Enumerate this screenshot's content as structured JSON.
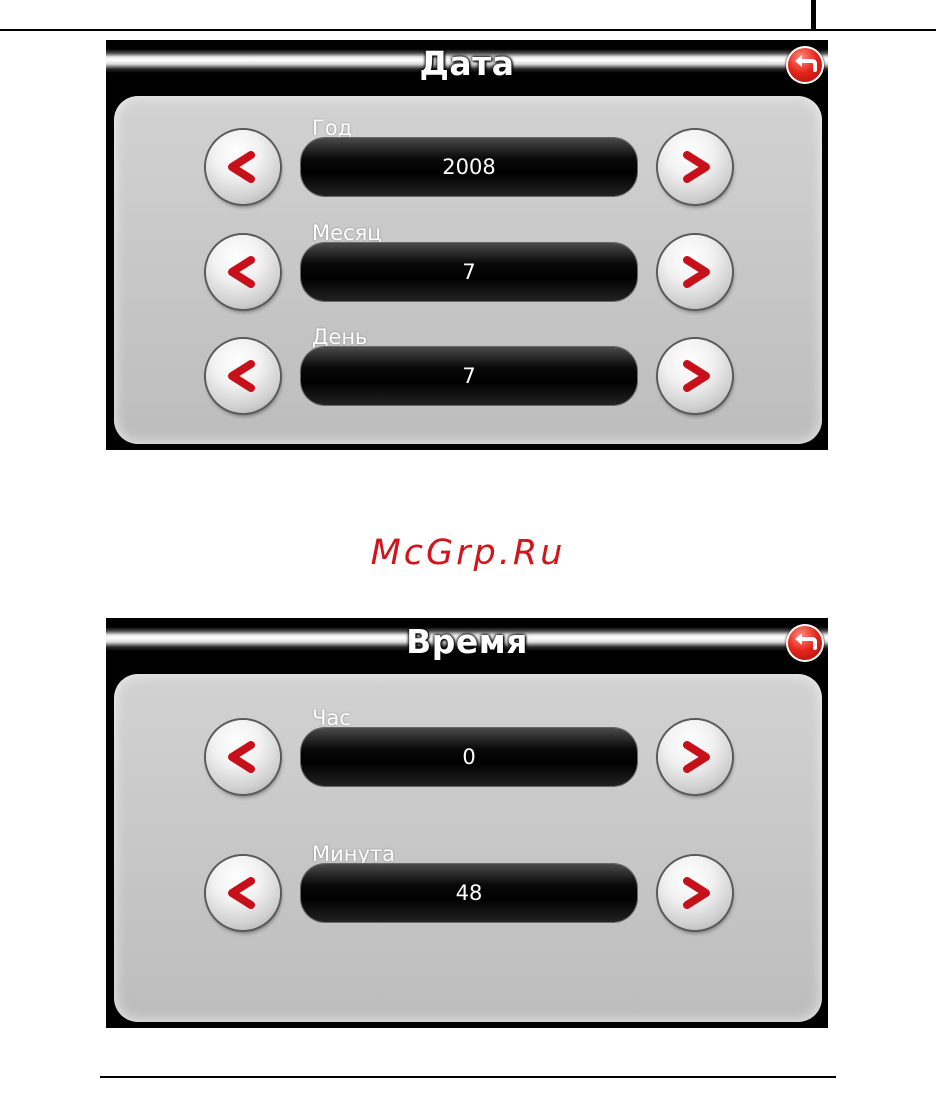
{
  "watermark": "McGrp.Ru",
  "date_screen": {
    "title": "Дата",
    "fields": [
      {
        "label": "Год",
        "value": "2008"
      },
      {
        "label": "Месяц",
        "value": "7"
      },
      {
        "label": "День",
        "value": "7"
      }
    ]
  },
  "time_screen": {
    "title": "Время",
    "fields": [
      {
        "label": "Час",
        "value": "0"
      },
      {
        "label": "Минута",
        "value": "48"
      }
    ]
  },
  "icons": {
    "back": "back-arrow-icon",
    "decrement": "chevron-left-icon",
    "increment": "chevron-right-icon"
  },
  "colors": {
    "arrow": "#c8101a",
    "watermark": "#d0161c",
    "back_button": "#e2241b"
  }
}
